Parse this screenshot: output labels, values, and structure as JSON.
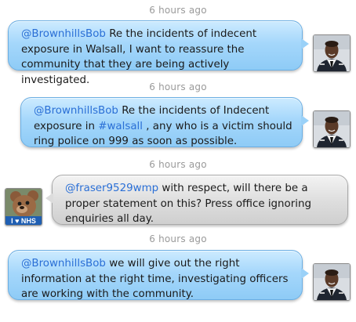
{
  "messages": [
    {
      "timestamp": "6 hours ago",
      "mention": "@BrownhillsBob",
      "text": " Re the incidents of indecent exposure in Walsall, I want to reassure the community that they are being actively investigated."
    },
    {
      "timestamp": "6 hours ago",
      "mention": "@BrownhillsBob",
      "text_before": " Re the incidents of Indecent exposure in ",
      "hashtag": "#walsall",
      "text_after": " , any who is a victim should ring police on 999 as soon as possible."
    },
    {
      "timestamp": "6 hours ago",
      "mention": "@fraser9529wmp",
      "text": " with respect, will there be a proper statement on this? Press office ignoring enquiries all day.",
      "avatar_badge": "I ♥ NHS"
    },
    {
      "timestamp": "6 hours ago",
      "mention": "@BrownhillsBob",
      "text": "  we will give out the right information at the right time, investigating officers are working with the community."
    }
  ],
  "colors": {
    "outgoing_bubble": "#a5d7fb",
    "incoming_bubble": "#dddddd",
    "link": "#2a6fd6",
    "timestamp": "#9a9a9a"
  },
  "icons": {
    "outgoing_avatar": "police-officer-avatar",
    "incoming_avatar": "teddy-bear-nhs-avatar"
  }
}
